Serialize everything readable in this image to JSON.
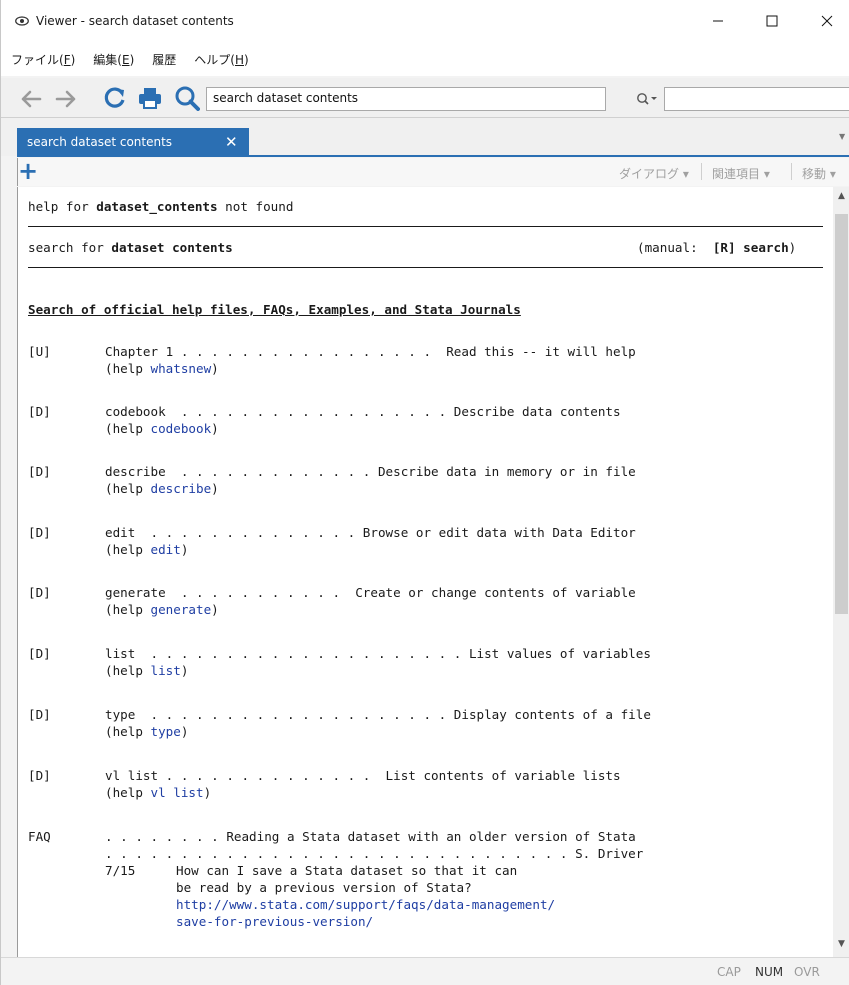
{
  "window": {
    "title": "Viewer - search dataset contents",
    "controls": {
      "minimize": "—",
      "maximize": "☐",
      "close": "✕"
    }
  },
  "menu": [
    {
      "text": "ファイル(",
      "key": "F",
      "suffix": ")"
    },
    {
      "text": "編集(",
      "key": "E",
      "suffix": ")"
    },
    {
      "text": "履歴",
      "key": "",
      "suffix": ""
    },
    {
      "text": "ヘルプ(",
      "key": "H",
      "suffix": ")"
    }
  ],
  "toolbar": {
    "search_value": "search dataset contents",
    "find_value": ""
  },
  "tab": {
    "label": "search dataset contents",
    "close": "✕"
  },
  "viewer_toolbar": {
    "dialog": "ダイアログ ▾",
    "related": "関連項目 ▾",
    "jump": "移動 ▾"
  },
  "content": {
    "not_found_prefix": "help for ",
    "not_found_term": "dataset_contents",
    "not_found_suffix": " not found",
    "search_prefix": "search for ",
    "search_term": "dataset contents",
    "manual_prefix": "(manual:  ",
    "manual_ref": "[R] search",
    "manual_suffix": ")",
    "heading": "Search of official help files, FAQs, Examples, and Stata Journals",
    "entries": [
      {
        "tag": "[U]",
        "line": "Chapter 1 . . . . . . . . . . . . . . . . .  Read this -- it will help",
        "help_prefix": "(help ",
        "help_link": "whatsnew",
        "help_suffix": ")"
      },
      {
        "tag": "[D]",
        "line": "codebook  . . . . . . . . . . . . . . . . . . Describe data contents",
        "help_prefix": "(help ",
        "help_link": "codebook",
        "help_suffix": ")"
      },
      {
        "tag": "[D]",
        "line": "describe  . . . . . . . . . . . . . Describe data in memory or in file",
        "help_prefix": "(help ",
        "help_link": "describe",
        "help_suffix": ")"
      },
      {
        "tag": "[D]",
        "line": "edit  . . . . . . . . . . . . . . Browse or edit data with Data Editor",
        "help_prefix": "(help ",
        "help_link": "edit",
        "help_suffix": ")"
      },
      {
        "tag": "[D]",
        "line": "generate  . . . . . . . . . . .  Create or change contents of variable",
        "help_prefix": "(help ",
        "help_link": "generate",
        "help_suffix": ")"
      },
      {
        "tag": "[D]",
        "line": "list  . . . . . . . . . . . . . . . . . . . . . List values of variables",
        "help_prefix": "(help ",
        "help_link": "list",
        "help_suffix": ")"
      },
      {
        "tag": "[D]",
        "line": "type  . . . . . . . . . . . . . . . . . . . . Display contents of a file",
        "help_prefix": "(help ",
        "help_link": "type",
        "help_suffix": ")"
      },
      {
        "tag": "[D]",
        "line": "vl list . . . . . . . . . . . . . .  List contents of variable lists",
        "help_prefix": "(help ",
        "help_link": "vl list",
        "help_suffix": ")"
      }
    ],
    "faq": {
      "tag": "FAQ",
      "line1": ". . . . . . . . Reading a Stata dataset with an older version of Stata",
      "line2": ". . . . . . . . . . . . . . . . . . . . . . . . . . . . . . . S. Driver",
      "date": "7/15",
      "q1": "How can I save a Stata dataset so that it can",
      "q2": "be read by a previous version of Stata?",
      "url1": "http://www.stata.com/support/faqs/data-management/",
      "url2": "save-for-previous-version/"
    }
  },
  "status": {
    "cap": "CAP",
    "num": "NUM",
    "ovr": "OVR"
  },
  "colors": {
    "accent": "#2b6fb3",
    "link": "#1f3ea3",
    "status_active": "#333333",
    "status_inactive": "#9a9a9a"
  }
}
